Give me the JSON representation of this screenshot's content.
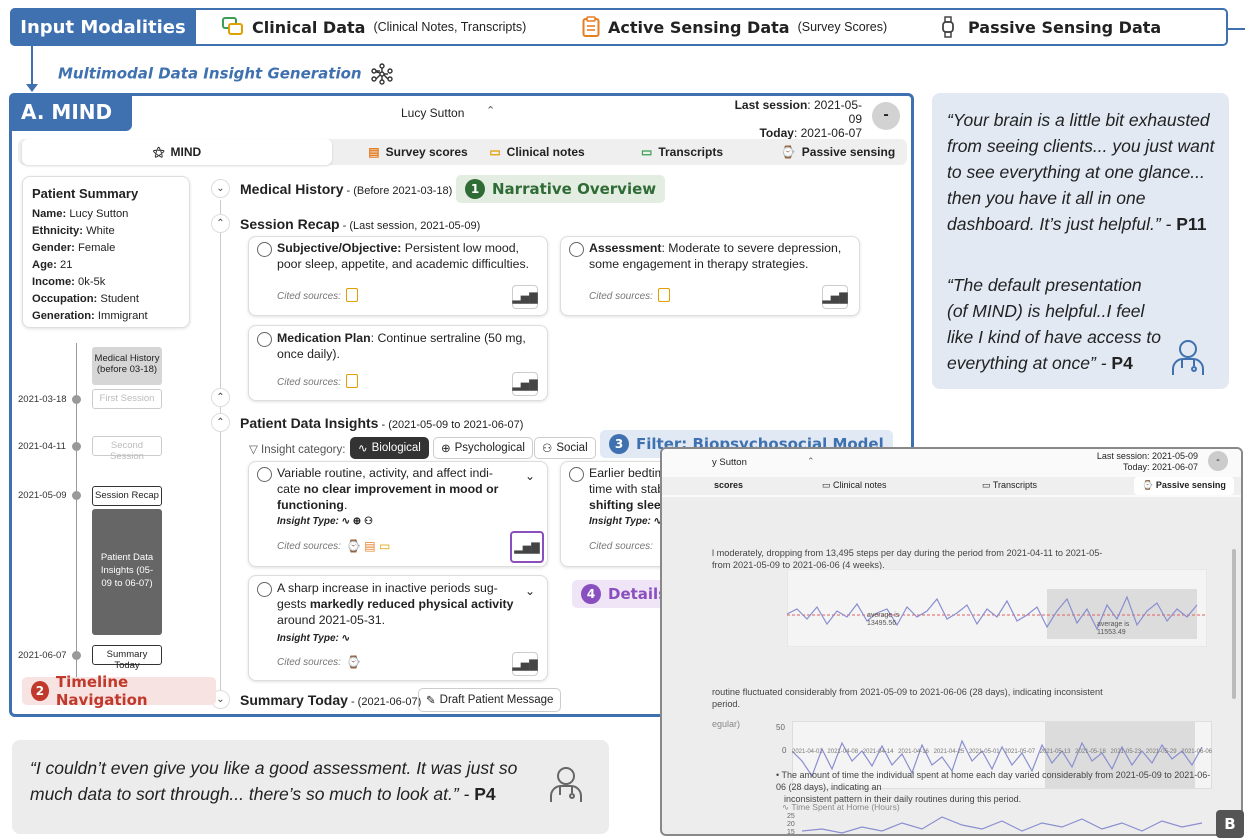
{
  "modalities": {
    "title": "Input Modalities",
    "clinical": {
      "label": "Clinical Data",
      "detail": "(Clinical Notes, Transcripts)"
    },
    "active": {
      "label": "Active Sensing Data",
      "detail": "(Survey Scores)"
    },
    "passive": {
      "label": "Passive Sensing Data"
    }
  },
  "insight_generation_title": "Multimodal Data Insight Generation",
  "mind": {
    "tag": "A. MIND",
    "patient_select": "Lucy Sutton",
    "last_session_label": "Last session",
    "last_session_value": ": 2021-05-09",
    "today_label": "Today",
    "today_value": ": 2021-06-07",
    "avatar_text": "-",
    "tabs": [
      "MIND",
      "Survey scores",
      "Clinical notes",
      "Transcripts",
      "Passive sensing"
    ]
  },
  "summary": {
    "title": "Patient Summary",
    "fields": [
      {
        "k": "Name:",
        "v": "Lucy Sutton"
      },
      {
        "k": "Ethnicity:",
        "v": "White"
      },
      {
        "k": "Gender:",
        "v": "Female"
      },
      {
        "k": "Age:",
        "v": "21"
      },
      {
        "k": "Income:",
        "v": "0k-5k"
      },
      {
        "k": "Occupation:",
        "v": "Student"
      },
      {
        "k": "Generation:",
        "v": "Immigrant"
      }
    ]
  },
  "timeline": {
    "medical_history": "Medical History (before 03-18)",
    "first": {
      "date": "2021-03-18",
      "label": "First Session"
    },
    "second": {
      "date": "2021-04-11",
      "label": "Second Session"
    },
    "recap": {
      "date": "2021-05-09",
      "label": "Session Recap"
    },
    "insights": "Patient Data Insights (05-09 to 06-07)",
    "today": {
      "date": "2021-06-07",
      "label": "Summary Today"
    }
  },
  "sections": {
    "medical_history": {
      "title": "Medical History",
      "sub": " - (Before 2021-03-18)"
    },
    "session_recap": {
      "title": "Session Recap",
      "sub": " - (Last session, 2021-05-09)"
    },
    "insights": {
      "title": "Patient Data Insights",
      "sub": " - (2021-05-09 to 2021-06-07)"
    },
    "summary_today": {
      "title": "Summary Today",
      "sub": " - (2021-06-07)"
    },
    "draft_button": "Draft Patient Message"
  },
  "recap_cards": {
    "subjective": {
      "bold": "Subjective/Objective:",
      "text": " Persistent low mood, poor sleep, appetite, and academic difficulties."
    },
    "assessment": {
      "bold": "Assessment",
      "text": ": Moderate to severe depression, some engagement in therapy strategies."
    },
    "medication": {
      "bold": "Medication Plan",
      "text": ": Continue sertraline (50 mg, once daily)."
    },
    "cited": "Cited sources:"
  },
  "filters": {
    "label": "Insight category:",
    "biological": "Biological",
    "psychological": "Psychological",
    "social": "Social"
  },
  "insight_cards": {
    "card1": {
      "text": "Variable routine, activity, and affect indi-cate ",
      "bold": "no clear improvement in mood or functioning",
      "end": "."
    },
    "card2": {
      "text": "Earlier bedtime and modestly later wake time with stable total sleep indicate ",
      "bold": "mildly shifting sleep patterns",
      "end": "."
    },
    "card3": {
      "text": "A sharp increase in inactive periods sug-gests ",
      "bold": "markedly reduced physical activity",
      "end": " around 2021-05-31."
    },
    "type_label": "Insight Type:",
    "cited": "Cited sources:"
  },
  "callouts": {
    "c1": {
      "num": "1",
      "text": "Narrative Overview",
      "color": "#2f6b35",
      "bg": "#e3ede2"
    },
    "c2": {
      "num": "2",
      "text": "Timeline Navigation",
      "color": "#c0392b",
      "bg": "#f8e3e3"
    },
    "c3": {
      "num": "3",
      "text": "Filter: Biopsychosocial Model",
      "color": "#3f71b0",
      "bg": "#e1e9f5"
    },
    "c4": {
      "num": "4",
      "text": "Details on Demand",
      "color": "#8a4fbf",
      "bg": "#efe5f7"
    }
  },
  "quotes": {
    "p11": "“Your brain is a little bit exhausted from seeing clients... you just want to see everything at one glance... then you have it all in one dashboard. It’s just helpful.” - ",
    "p11_who": "P11",
    "p4a": "“The default presentation (of MIND) is helpful..I feel like I kind of have access to everything at once” - ",
    "p4a_who": "P4",
    "p4b": "“I couldn’t even give you like a good assessment. It was just so much data to sort through... there’s so much to look at.” - ",
    "p4b_who": "P4"
  },
  "panel_b": {
    "tag": "B",
    "patient": "y Sutton",
    "last_session": "Last session: 2021-05-09",
    "today": "Today: 2021-06-07",
    "tabs": [
      "scores",
      "Clinical notes",
      "Transcripts",
      "Passive sensing"
    ],
    "text1": "l moderately, dropping from 13,495 steps per day during the period from 2021-04-11 to 2021-05-",
    "text1b": "from 2021-05-09 to 2021-06-06 (4 weeks).",
    "avg1": "average is 13495.56",
    "avg2": "average is 11553.49",
    "text2": "routine fluctuated considerably from 2021-05-09 to 2021-06-06 (28 days), indicating inconsistent",
    "text2b": "period.",
    "chart2_label": "egular)",
    "text3": "The amount of time the individual spent at home each day varied considerably from 2021-05-09 to 2021-06-06 (28 days), indicating an",
    "text3b": "inconsistent pattern in their daily routines during this period.",
    "chart3_label": "Time Spent at Home (Hours)",
    "ticks_x": [
      "2021-04-02",
      "2021-04-08",
      "2021-04-14",
      "2021-04-16",
      "2021-04-25",
      "2021-05-01",
      "2021-05-07",
      "2021-05-13",
      "2021-05-18",
      "2021-05-23",
      "2021-05-29",
      "2021-06-06"
    ],
    "ticks_y2": [
      "50",
      "0"
    ],
    "ticks_y3": [
      "25",
      "20",
      "15"
    ]
  }
}
